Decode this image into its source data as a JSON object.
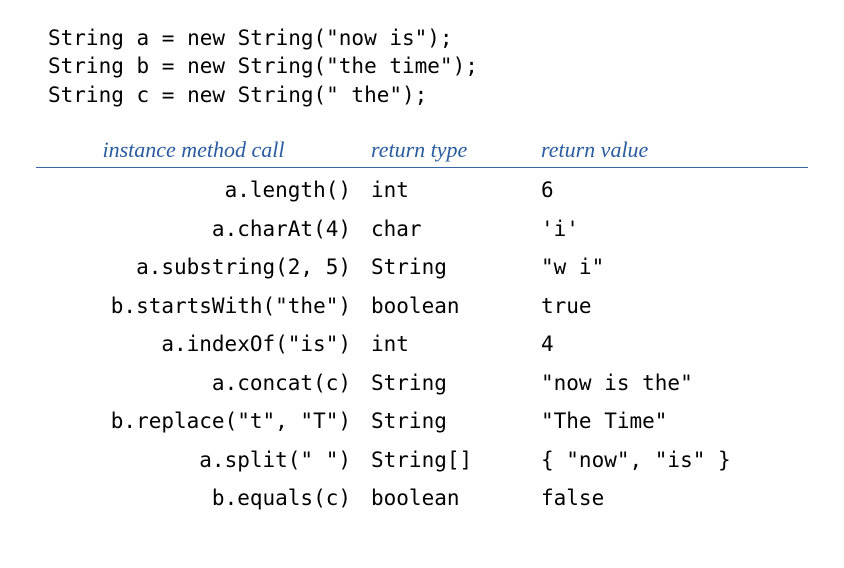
{
  "code": {
    "line1": "String a = new String(\"now is\");",
    "line2": "String b = new String(\"the time\");",
    "line3": "String c = new String(\" the\");"
  },
  "headers": {
    "method": "instance method call",
    "type": "return type",
    "value": "return value"
  },
  "rows": [
    {
      "method": "a.length()",
      "type": "int",
      "value": "6"
    },
    {
      "method": "a.charAt(4)",
      "type": "char",
      "value": "'i'"
    },
    {
      "method": "a.substring(2, 5)",
      "type": "String",
      "value": "\"w i\""
    },
    {
      "method": "b.startsWith(\"the\")",
      "type": "boolean",
      "value": "true"
    },
    {
      "method": "a.indexOf(\"is\")",
      "type": "int",
      "value": "4"
    },
    {
      "method": "a.concat(c)",
      "type": "String",
      "value": "\"now is the\""
    },
    {
      "method": "b.replace(\"t\", \"T\")",
      "type": "String",
      "value": "\"The Time\""
    },
    {
      "method": "a.split(\" \")",
      "type": "String[]",
      "value": "{ \"now\", \"is\" }"
    },
    {
      "method": "b.equals(c)",
      "type": "boolean",
      "value": "false"
    }
  ],
  "chart_data": {
    "type": "table",
    "title": "Java String instance method examples",
    "columns": [
      "instance method call",
      "return type",
      "return value"
    ],
    "rows": [
      [
        "a.length()",
        "int",
        "6"
      ],
      [
        "a.charAt(4)",
        "char",
        "'i'"
      ],
      [
        "a.substring(2, 5)",
        "String",
        "\"w i\""
      ],
      [
        "b.startsWith(\"the\")",
        "boolean",
        "true"
      ],
      [
        "a.indexOf(\"is\")",
        "int",
        "4"
      ],
      [
        "a.concat(c)",
        "String",
        "\"now is the\""
      ],
      [
        "b.replace(\"t\", \"T\")",
        "String",
        "\"The Time\""
      ],
      [
        "a.split(\" \")",
        "String[]",
        "{ \"now\", \"is\" }"
      ],
      [
        "b.equals(c)",
        "boolean",
        "false"
      ]
    ]
  }
}
